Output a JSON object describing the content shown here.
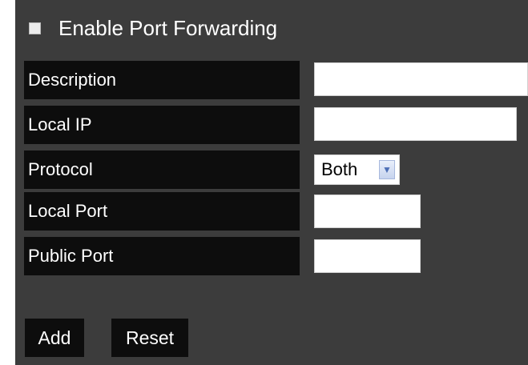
{
  "port_forwarding": {
    "enable_label": "Enable Port Forwarding",
    "enabled": false
  },
  "fields": {
    "description": {
      "label": "Description",
      "value": ""
    },
    "local_ip": {
      "label": "Local IP",
      "value": ""
    },
    "protocol": {
      "label": "Protocol",
      "value": "Both"
    },
    "local_port": {
      "label": "Local Port",
      "value": ""
    },
    "public_port": {
      "label": "Public Port",
      "value": ""
    }
  },
  "buttons": {
    "add": "Add",
    "reset": "Reset"
  },
  "icons": {
    "dropdown": "chevron-down-icon"
  }
}
